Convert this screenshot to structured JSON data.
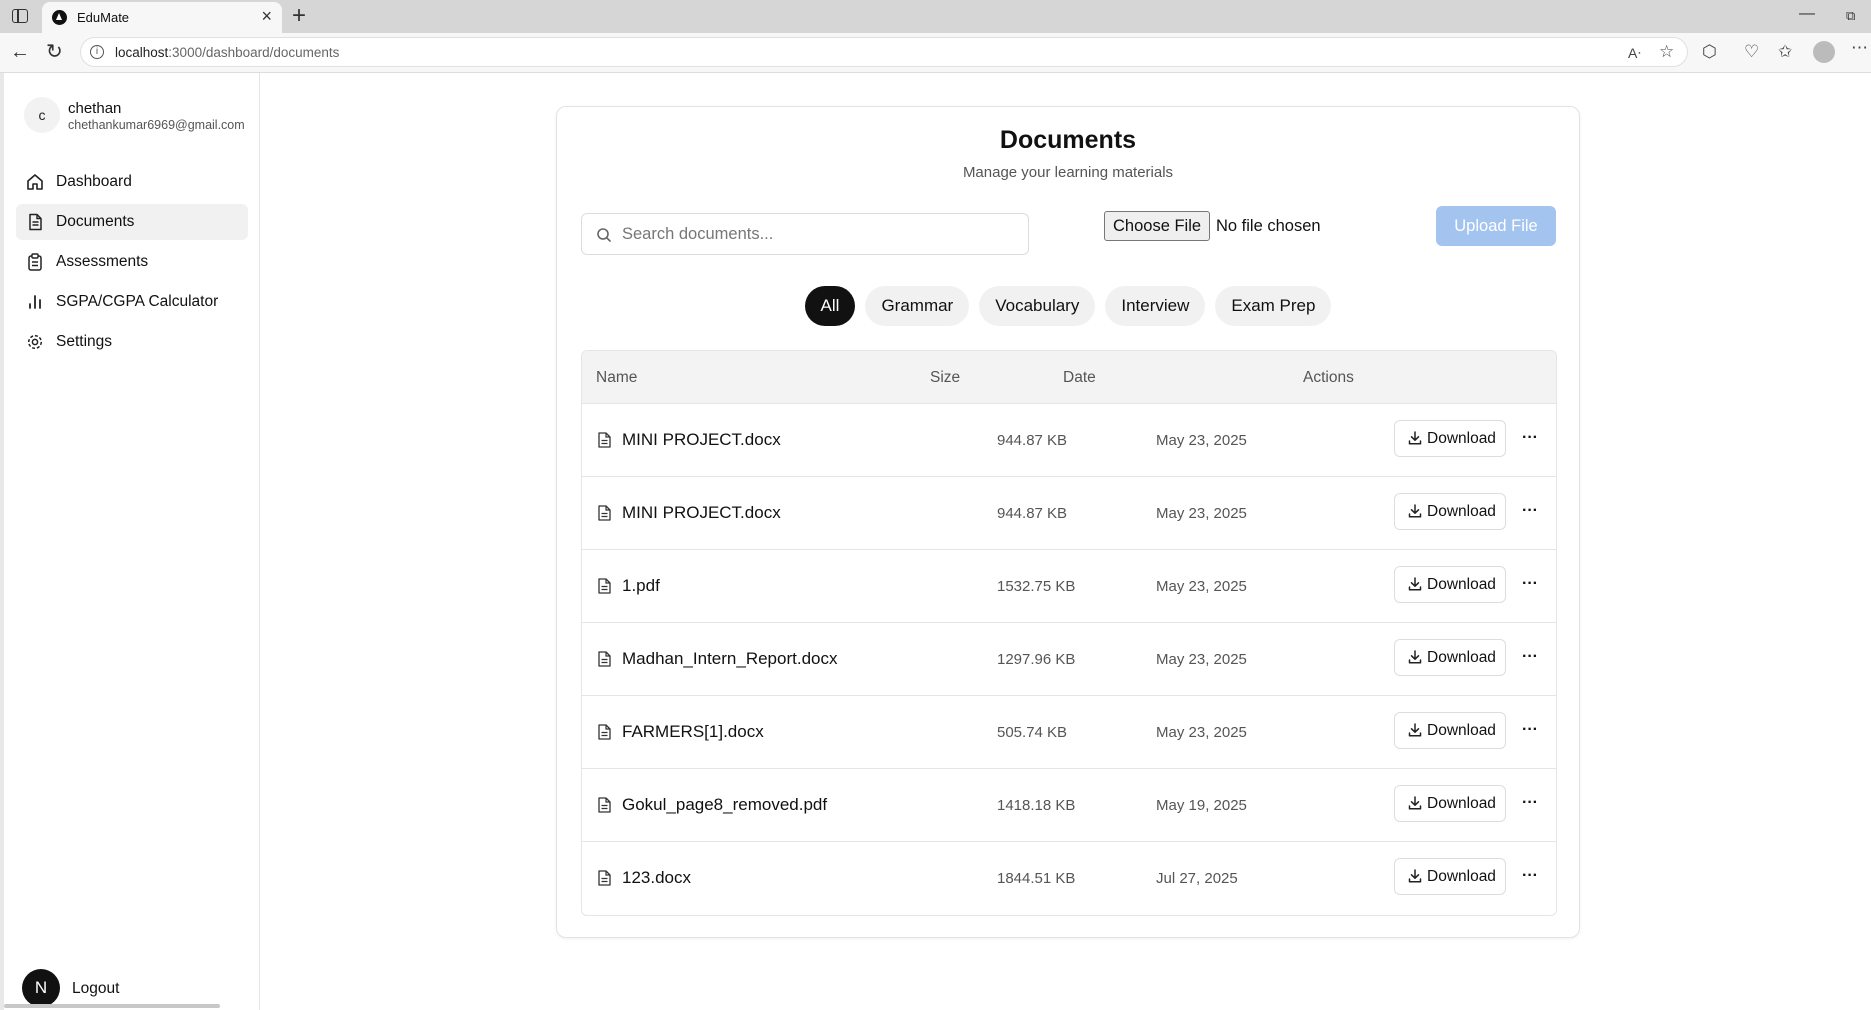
{
  "browser": {
    "tab_title": "EduMate",
    "url_host": "localhost",
    "url_path": ":3000/dashboard/documents"
  },
  "sidebar": {
    "user": {
      "initial": "c",
      "name": "chethan",
      "email": "chethankumar6969@gmail.com"
    },
    "items": [
      {
        "label": "Dashboard",
        "icon": "home-icon",
        "active": false
      },
      {
        "label": "Documents",
        "icon": "document-icon",
        "active": true
      },
      {
        "label": "Assessments",
        "icon": "clipboard-icon",
        "active": false
      },
      {
        "label": "SGPA/CGPA Calculator",
        "icon": "bar-chart-icon",
        "active": false
      },
      {
        "label": "Settings",
        "icon": "gear-icon",
        "active": false
      }
    ],
    "logout": {
      "avatar_letter": "N",
      "label": "Logout"
    }
  },
  "main": {
    "title": "Documents",
    "subtitle": "Manage your learning materials",
    "search_placeholder": "Search documents...",
    "choose_file_label": "Choose File",
    "no_file_text": "No file chosen",
    "upload_label": "Upload File",
    "filters": [
      "All",
      "Grammar",
      "Vocabulary",
      "Interview",
      "Exam Prep"
    ],
    "active_filter": "All",
    "table": {
      "headers": {
        "name": "Name",
        "size": "Size",
        "date": "Date",
        "actions": "Actions"
      },
      "download_label": "Download",
      "more_label": "···",
      "rows": [
        {
          "name": "MINI PROJECT.docx",
          "size": "944.87 KB",
          "date": "May 23, 2025"
        },
        {
          "name": "MINI PROJECT.docx",
          "size": "944.87 KB",
          "date": "May 23, 2025"
        },
        {
          "name": "1.pdf",
          "size": "1532.75 KB",
          "date": "May 23, 2025"
        },
        {
          "name": "Madhan_Intern_Report.docx",
          "size": "1297.96 KB",
          "date": "May 23, 2025"
        },
        {
          "name": "FARMERS[1].docx",
          "size": "505.74 KB",
          "date": "May 23, 2025"
        },
        {
          "name": "Gokul_page8_removed.pdf",
          "size": "1418.18 KB",
          "date": "May 19, 2025"
        },
        {
          "name": "123.docx",
          "size": "1844.51 KB",
          "date": "Jul 27, 2025"
        }
      ]
    }
  },
  "colors": {
    "upload_button": "#a3c4ee",
    "active_chip": "#111111"
  }
}
